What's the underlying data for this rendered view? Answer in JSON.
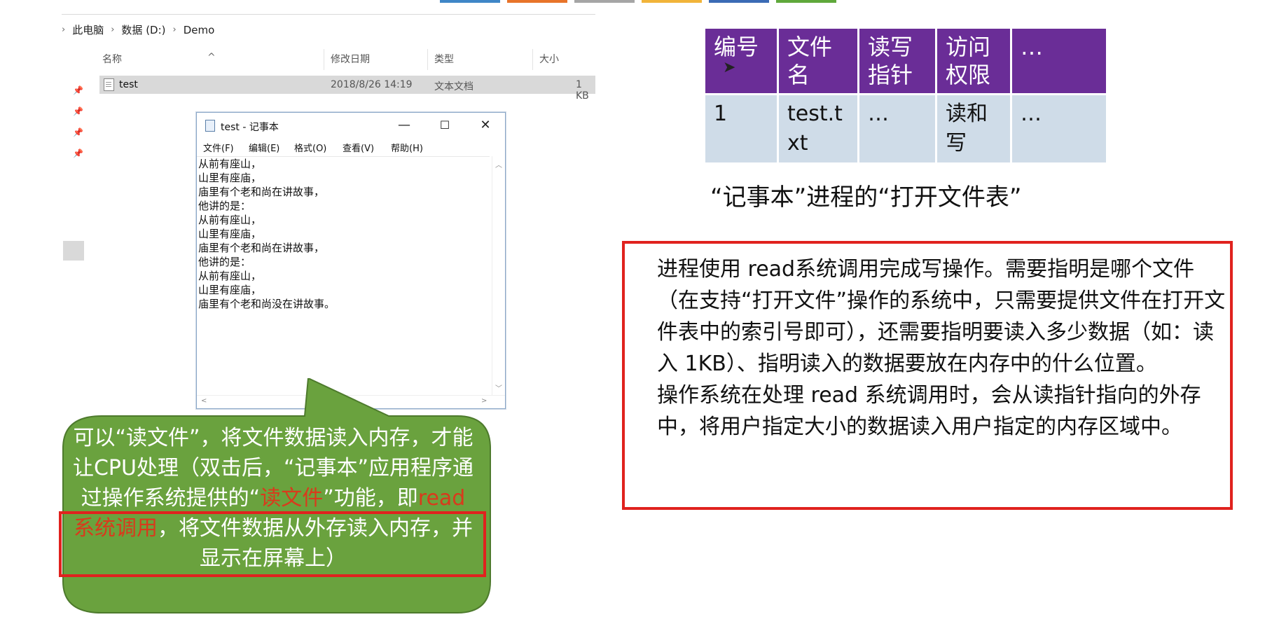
{
  "topbar": {
    "colors": [
      "#3f86c7",
      "#e8742a",
      "#a5a5a5",
      "#f1b43a",
      "#3b6bb5",
      "#5fa83b"
    ]
  },
  "explorer": {
    "breadcrumb": [
      "此电脑",
      "数据 (D:)",
      "Demo"
    ],
    "columns": {
      "name": "名称",
      "modified": "修改日期",
      "type": "类型",
      "size": "大小"
    },
    "file": {
      "name": "test",
      "modified": "2018/8/26 14:19",
      "type": "文本文档",
      "size": "1 KB"
    }
  },
  "notepad": {
    "title": "test - 记事本",
    "buttons": {
      "minimize": "—",
      "maximize": "☐",
      "close": "✕"
    },
    "menu": [
      "文件(F)",
      "编辑(E)",
      "格式(O)",
      "查看(V)",
      "帮助(H)"
    ],
    "lines": [
      "从前有座山，",
      "山里有座庙，",
      "庙里有个老和尚在讲故事，",
      "他讲的是：",
      "从前有座山，",
      "山里有座庙，",
      "庙里有个老和尚在讲故事，",
      "他讲的是：",
      "从前有座山，",
      "山里有座庙，",
      "庙里有个老和尚没在讲故事。"
    ]
  },
  "callout": {
    "p1": "可以“读文件”，将文件数据读入内存，才能让CPU处理（双击后，“记事本”应用程序通过操作系统提供的“",
    "hl1": "读文件",
    "p2": "”功能，即",
    "hl2": "read 系统调用",
    "p3": "，将文件数据从外存读入内存，并显示在屏幕上）",
    "fill_color": "#6aa23e"
  },
  "open_file_table": {
    "headers": [
      "编号",
      "文件名",
      "读写指针",
      "访问权限",
      "…"
    ],
    "rows": [
      [
        "1",
        "test.txt",
        "…",
        "读和写",
        "…"
      ]
    ],
    "caption": "“记事本”进程的“打开文件表”"
  },
  "description": {
    "p1": "进程使用 read系统调用完成写操作。需要指明是哪个文件（在支持“打开文件”操作的系统中，只需要提供文件在打开文件表中的索引号即可），还需要指明要读入多少数据（如：读入 1KB）、指明读入的数据要放在内存中的什么位置。",
    "p2": "操作系统在处理 read 系统调用时，会从读指针指向的外存中，将用户指定大小的数据读入用户指定的内存区域中。"
  }
}
